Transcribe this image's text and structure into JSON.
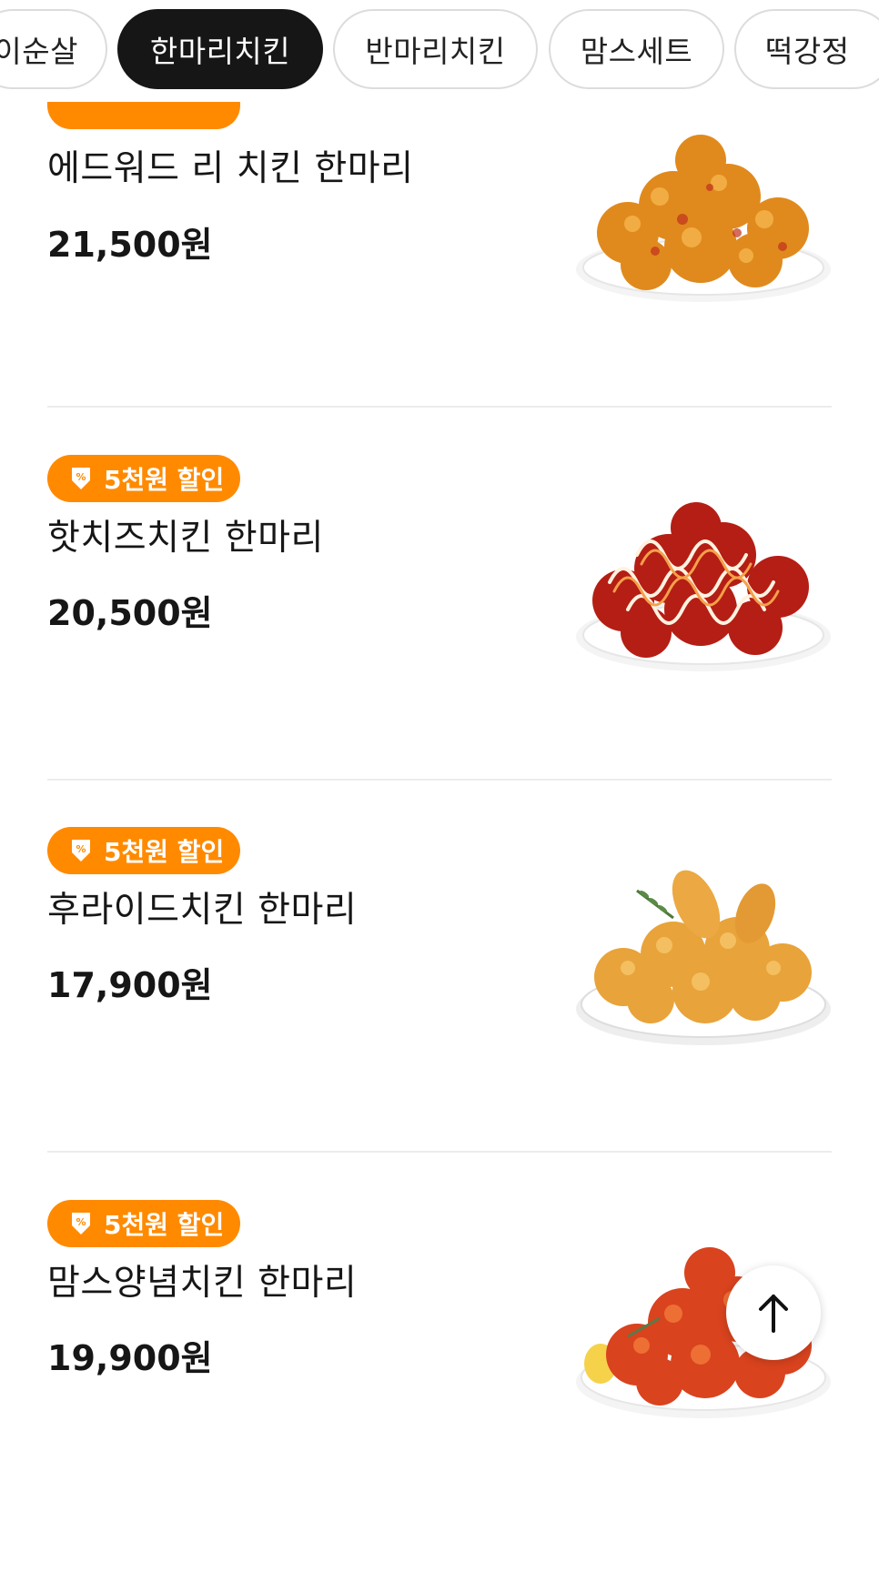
{
  "tabs": [
    {
      "label": "이순살",
      "active": false
    },
    {
      "label": "한마리치킨",
      "active": true
    },
    {
      "label": "반마리치킨",
      "active": false
    },
    {
      "label": "맘스세트",
      "active": false
    },
    {
      "label": "떡강정",
      "active": false
    }
  ],
  "menu": {
    "items": [
      {
        "name": "에드워드 리 치킨 한마리",
        "price": "21,500원",
        "badge": "",
        "image": "cheese-crusted-chicken"
      },
      {
        "name": "핫치즈치킨 한마리",
        "price": "20,500원",
        "badge": "5천원 할인",
        "image": "hot-cheese-sauced-chicken"
      },
      {
        "name": "후라이드치킨 한마리",
        "price": "17,900원",
        "badge": "5천원 할인",
        "image": "fried-chicken-with-rosemary"
      },
      {
        "name": "맘스양념치킨 한마리",
        "price": "19,900원",
        "badge": "5천원 할인",
        "image": "glazed-yangnyeom-chicken"
      }
    ]
  },
  "colors": {
    "accent": "#ff8a00",
    "active_tab": "#161616",
    "divider": "#ececec"
  },
  "icons": {
    "badge": "coupon-download-icon",
    "fab": "arrow-up-icon"
  }
}
